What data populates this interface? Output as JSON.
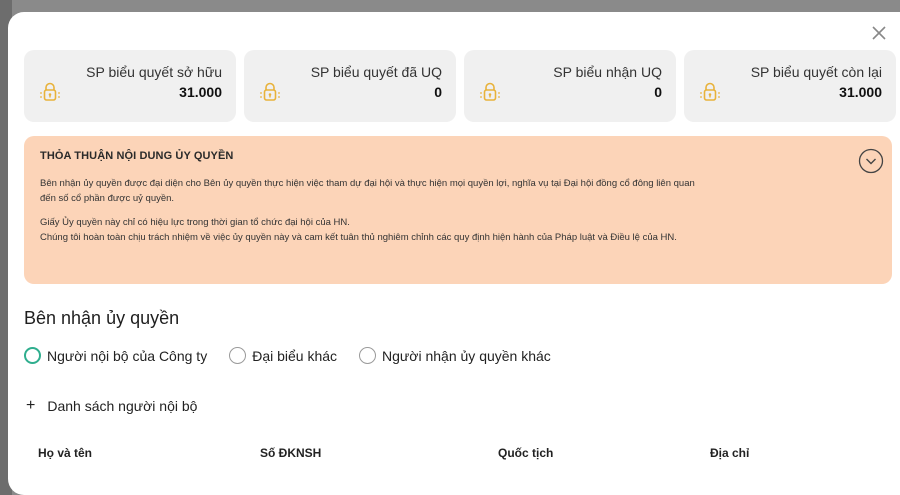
{
  "close_icon": "close-icon",
  "cards": [
    {
      "icon": "lock-icon",
      "label": "SP biểu quyết sở hữu",
      "value": "31.000"
    },
    {
      "icon": "lock-icon",
      "label": "SP biểu quyết đã UQ",
      "value": "0"
    },
    {
      "icon": "lock-icon",
      "label": "SP biểu nhận UQ",
      "value": "0"
    },
    {
      "icon": "lock-icon",
      "label": "SP biểu quyết còn lại",
      "value": "31.000"
    }
  ],
  "colors": {
    "card_bg": "#f0f0f0",
    "notice_bg": "#fcd4b8",
    "lock_icon": "#e8b23a",
    "radio_selected": "#2fae8e"
  },
  "notice": {
    "title": "THỎA THUẬN NỘI DUNG ỦY QUYỀN",
    "paragraph_1_line_1": "Bên nhận ủy quyền được đại diện cho Bên ủy quyền thực hiện việc tham dự đại hội và thực hiện mọi quyền lợi, nghĩa vụ tại Đại hội đồng cổ đông liên quan",
    "paragraph_1_line_2": "đến số cổ phần được uỷ quyền.",
    "paragraph_2_line_1": "Giấy Ủy quyền này chỉ có hiệu lực trong thời gian tổ chức đại hội của HN.",
    "paragraph_2_line_2": "Chúng tôi hoàn toàn chịu trách nhiệm về việc ủy quyền này và cam kết tuân thủ nghiêm chỉnh các quy định hiện hành của Pháp luật và Điều lệ của HN."
  },
  "receiver": {
    "title": "Bên nhận ủy quyền",
    "options": [
      {
        "label": "Người nội bộ của Công ty",
        "selected": true
      },
      {
        "label": "Đại biểu khác",
        "selected": false
      },
      {
        "label": "Người nhận ủy quyền khác",
        "selected": false
      }
    ],
    "add_list_label": "Danh sách người nội bộ"
  },
  "table": {
    "columns": [
      "Họ và tên",
      "Số ĐKNSH",
      "Quốc tịch",
      "Địa chỉ"
    ]
  }
}
